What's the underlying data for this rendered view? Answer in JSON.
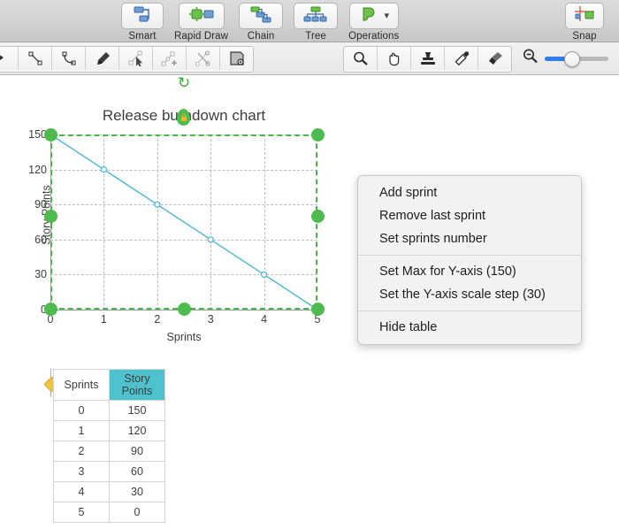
{
  "toolbar_top": {
    "items": [
      {
        "label": "Smart",
        "icon": "smart-connector-icon"
      },
      {
        "label": "Rapid Draw",
        "icon": "rapid-draw-icon"
      },
      {
        "label": "Chain",
        "icon": "chain-icon"
      },
      {
        "label": "Tree",
        "icon": "tree-icon"
      },
      {
        "label": "Operations",
        "icon": "operations-icon",
        "has_chevron": true
      }
    ],
    "right_item": {
      "label": "Snap",
      "icon": "snap-icon"
    }
  },
  "toolbar_second": {
    "left_tools": [
      {
        "name": "line-tool-icon"
      },
      {
        "name": "curve-tool-icon"
      },
      {
        "name": "pen-tool-icon"
      },
      {
        "name": "node-select-icon"
      },
      {
        "name": "add-node-icon"
      },
      {
        "name": "cut-path-icon"
      },
      {
        "name": "mask-tool-icon"
      }
    ],
    "right_tools": [
      {
        "name": "magnifier-icon"
      },
      {
        "name": "hand-icon"
      },
      {
        "name": "stamp-icon"
      },
      {
        "name": "eyedropper-icon"
      },
      {
        "name": "paintbrush-icon"
      }
    ],
    "zoom": {
      "icon": "zoom-out-icon",
      "value": 26
    }
  },
  "chart_data": {
    "type": "line",
    "title": "Release burndown chart",
    "xlabel": "Sprints",
    "ylabel": "Story Points",
    "x": [
      0,
      1,
      2,
      3,
      4,
      5
    ],
    "values": [
      150,
      120,
      90,
      60,
      30,
      0
    ],
    "xticks": [
      "0",
      "1",
      "2",
      "3",
      "4",
      "5"
    ],
    "yticks": [
      "150",
      "120",
      "90",
      "60",
      "30",
      "0"
    ],
    "xlim": [
      0,
      5
    ],
    "ylim": [
      0,
      150
    ],
    "grid": true,
    "legend": "none",
    "series_color": "#4ab4d4",
    "marker": "open-circle"
  },
  "table": {
    "headers": [
      "Sprints",
      "Story Points"
    ],
    "header_highlight_color": "#4ec3cd",
    "rows": [
      [
        "0",
        "150"
      ],
      [
        "1",
        "120"
      ],
      [
        "2",
        "90"
      ],
      [
        "3",
        "60"
      ],
      [
        "4",
        "30"
      ],
      [
        "5",
        "0"
      ]
    ]
  },
  "context_menu": {
    "groups": [
      [
        "Add sprint",
        "Remove last sprint",
        "Set sprints number"
      ],
      [
        "Set Max for Y-axis (150)",
        "Set the Y-axis scale step (30)"
      ],
      [
        "Hide table"
      ]
    ]
  },
  "selection": {
    "color": "#49b749",
    "handle_color": "#4dbb4d",
    "rotate_icon": "rotate-icon"
  }
}
